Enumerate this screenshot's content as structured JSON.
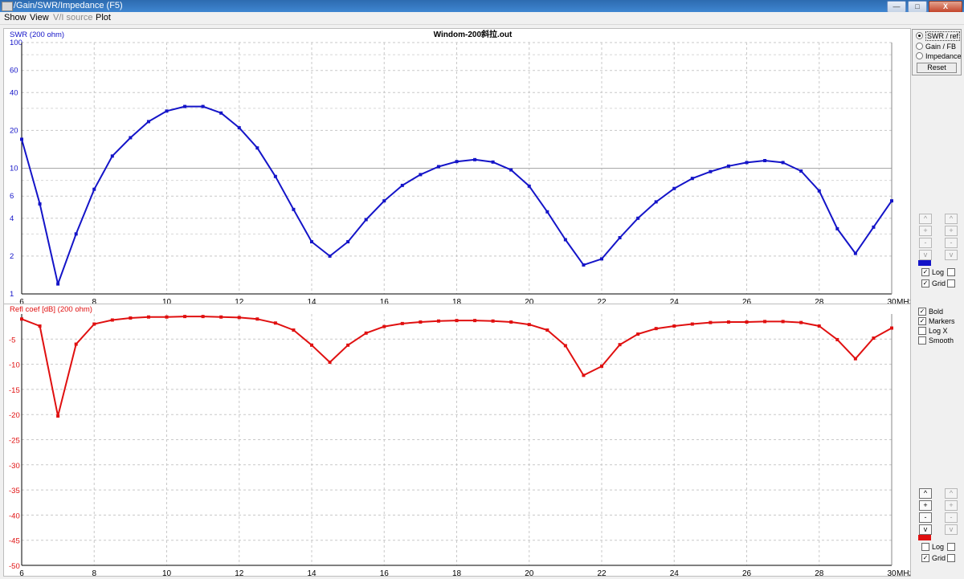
{
  "window": {
    "title": "/Gain/SWR/Impedance (F5)",
    "buttons": {
      "minimize": "—",
      "maximize": "□",
      "close": "X"
    }
  },
  "menu": {
    "items": [
      {
        "label": "Show",
        "enabled": true
      },
      {
        "label": "View",
        "enabled": true
      },
      {
        "label": "V/I source",
        "enabled": false
      },
      {
        "label": "Plot",
        "enabled": true
      }
    ]
  },
  "colors": {
    "swr": "#1414c8",
    "refl": "#e01010",
    "grid": "#c8c8c8"
  },
  "top_plot": {
    "title": "Windom-200斜拉.out",
    "ylabel": "SWR (200 ohm)",
    "x_unit": "MHz",
    "x_ticks": [
      "6",
      "8",
      "10",
      "12",
      "14",
      "16",
      "18",
      "20",
      "22",
      "24",
      "26",
      "28",
      "30"
    ],
    "y_ticks": [
      "1",
      "2",
      "4",
      "6",
      "10",
      "20",
      "40",
      "60",
      "100"
    ]
  },
  "bottom_plot": {
    "ylabel": "Refl coef [dB] (200 ohm)",
    "x_unit": "MHz",
    "x_ticks": [
      "6",
      "8",
      "10",
      "12",
      "14",
      "16",
      "18",
      "20",
      "22",
      "24",
      "26",
      "28",
      "30"
    ],
    "y_ticks": [
      "-5",
      "-10",
      "-15",
      "-20",
      "-25",
      "-30",
      "-35",
      "-40",
      "-45",
      "-50"
    ]
  },
  "chart_data": [
    {
      "type": "line",
      "title": "Windom-200斜拉.out",
      "xlabel": "MHz",
      "ylabel": "SWR (200 ohm)",
      "yscale": "log",
      "xlim": [
        6,
        30
      ],
      "ylim": [
        1,
        100
      ],
      "grid": true,
      "markers": true,
      "series": [
        {
          "x": [
            6,
            6.5,
            7,
            7.5,
            8,
            8.5,
            9,
            9.5,
            10,
            10.5,
            11,
            11.5,
            12,
            12.5,
            13,
            13.5,
            14,
            14.5,
            15,
            15.5,
            16,
            16.5,
            17,
            17.5,
            18,
            18.5,
            19,
            19.5,
            20,
            20.5,
            21,
            21.5,
            22,
            22.5,
            23,
            23.5,
            24,
            24.5,
            25,
            25.5,
            26,
            26.5,
            27,
            27.5,
            28,
            28.5,
            29,
            29.5,
            30
          ],
          "y": [
            17,
            5.2,
            1.2,
            3,
            6.8,
            12.5,
            17.5,
            23.5,
            28.5,
            31,
            31,
            27.5,
            21,
            14.5,
            8.6,
            4.7,
            2.6,
            2,
            2.6,
            3.9,
            5.5,
            7.3,
            8.9,
            10.3,
            11.3,
            11.7,
            11.2,
            9.7,
            7.2,
            4.5,
            2.7,
            1.7,
            1.9,
            2.8,
            4,
            5.4,
            6.9,
            8.3,
            9.4,
            10.4,
            11.1,
            11.5,
            11.1,
            9.5,
            6.6,
            3.3,
            2.1,
            3.4,
            5.5
          ]
        }
      ]
    },
    {
      "type": "line",
      "xlabel": "MHz",
      "ylabel": "Refl coef [dB] (200 ohm)",
      "xlim": [
        6,
        30
      ],
      "ylim": [
        -50,
        0
      ],
      "grid": true,
      "markers": true,
      "series": [
        {
          "x": [
            6,
            6.5,
            7,
            7.5,
            8,
            8.5,
            9,
            9.5,
            10,
            10.5,
            11,
            11.5,
            12,
            12.5,
            13,
            13.5,
            14,
            14.5,
            15,
            15.5,
            16,
            16.5,
            17,
            17.5,
            18,
            18.5,
            19,
            19.5,
            20,
            20.5,
            21,
            21.5,
            22,
            22.5,
            23,
            23.5,
            24,
            24.5,
            25,
            25.5,
            26,
            26.5,
            27,
            27.5,
            28,
            28.5,
            29,
            29.5,
            30
          ],
          "y": [
            -1,
            -2.4,
            -20.3,
            -6,
            -2,
            -1.2,
            -0.8,
            -0.6,
            -0.6,
            -0.5,
            -0.5,
            -0.6,
            -0.7,
            -1,
            -1.8,
            -3.2,
            -6.2,
            -9.6,
            -6.2,
            -3.8,
            -2.5,
            -1.9,
            -1.6,
            -1.4,
            -1.3,
            -1.3,
            -1.4,
            -1.6,
            -2.1,
            -3.2,
            -6.3,
            -12.2,
            -10.4,
            -6.1,
            -4,
            -2.9,
            -2.4,
            -2,
            -1.7,
            -1.6,
            -1.6,
            -1.5,
            -1.5,
            -1.7,
            -2.4,
            -5.1,
            -8.9,
            -4.8,
            -2.8
          ]
        }
      ]
    }
  ],
  "sidebar": {
    "mode_options": [
      {
        "label": "SWR / ref",
        "selected": true
      },
      {
        "label": "Gain / FB",
        "selected": false
      },
      {
        "label": "Impedance",
        "selected": false
      }
    ],
    "reset_label": "Reset",
    "top_scale": {
      "log_label": "Log",
      "log_checked": true,
      "grid_label": "Grid",
      "grid_checked": true
    },
    "options": [
      {
        "label": "Bold",
        "checked": true
      },
      {
        "label": "Markers",
        "checked": true
      },
      {
        "label": "Log X",
        "checked": false
      },
      {
        "label": "Smooth",
        "checked": false
      }
    ],
    "bottom_scale": {
      "log_label": "Log",
      "log_checked": false,
      "grid_label": "Grid",
      "grid_checked": true
    }
  }
}
